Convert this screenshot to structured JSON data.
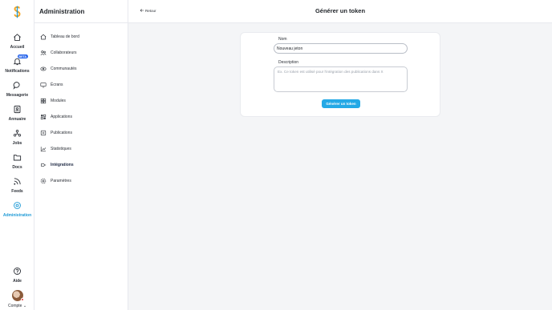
{
  "rail": {
    "items": [
      {
        "label": "Accueil",
        "icon": "home-icon"
      },
      {
        "label": "Notifications",
        "icon": "bell-icon",
        "badge": "BETA"
      },
      {
        "label": "Messagerie",
        "icon": "chat-icon"
      },
      {
        "label": "Annuaire",
        "icon": "directory-icon"
      },
      {
        "label": "Jobs",
        "icon": "jobs-icon"
      },
      {
        "label": "Docs",
        "icon": "folder-icon"
      },
      {
        "label": "Feeds",
        "icon": "rss-icon"
      },
      {
        "label": "Administration",
        "icon": "admin-icon",
        "active": true
      }
    ],
    "help_label": "Aide",
    "account_label": "Compte ⌄"
  },
  "sidebar": {
    "title": "Administration",
    "items": [
      {
        "label": "Tableau de bord",
        "icon": "dashboard-icon"
      },
      {
        "label": "Collaborateurs",
        "icon": "users-icon"
      },
      {
        "label": "Communautés",
        "icon": "community-icon"
      },
      {
        "label": "Écrans",
        "icon": "screen-icon"
      },
      {
        "label": "Modules",
        "icon": "modules-icon"
      },
      {
        "label": "Applications",
        "icon": "apps-icon"
      },
      {
        "label": "Publications",
        "icon": "publications-icon"
      },
      {
        "label": "Statistiques",
        "icon": "stats-icon"
      },
      {
        "label": "Intégrations",
        "icon": "integrations-icon",
        "active": true
      },
      {
        "label": "Paramètres",
        "icon": "settings-icon"
      }
    ]
  },
  "header": {
    "back_label": "Retour",
    "title": "Générer un token"
  },
  "form": {
    "name_label": "Nom",
    "name_value": "Nouveau jeton",
    "description_label": "Description",
    "description_placeholder": "Ex. Ce token est utilisé pour l'intégration des publications dans X",
    "submit_label": "Générer un token"
  },
  "colors": {
    "accent": "#24a9e6",
    "active_text": "#1e9ad6",
    "badge": "#2563eb"
  }
}
